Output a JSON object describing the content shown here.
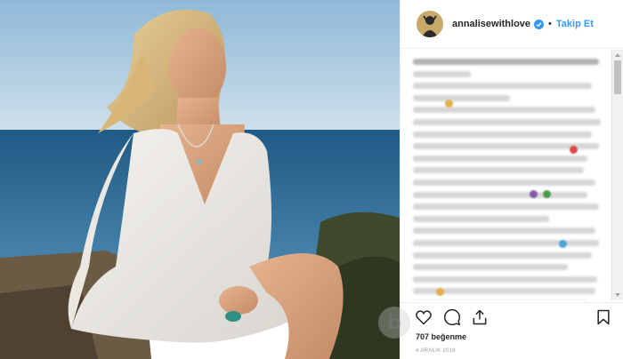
{
  "post": {
    "username": "annalisewithlove",
    "separator": "•",
    "follow_label": "Takip Et",
    "likes_text": "707 beğenme",
    "date_text": "4 ARALIK 2018"
  },
  "icons": {
    "verified": "verified-badge-icon",
    "like": "heart-icon",
    "comment": "comment-icon",
    "share": "share-icon",
    "save": "bookmark-icon"
  },
  "colors": {
    "accent": "#3897f0",
    "text": "#262626",
    "muted": "#999999"
  },
  "watermark": {
    "glyph": "b"
  }
}
